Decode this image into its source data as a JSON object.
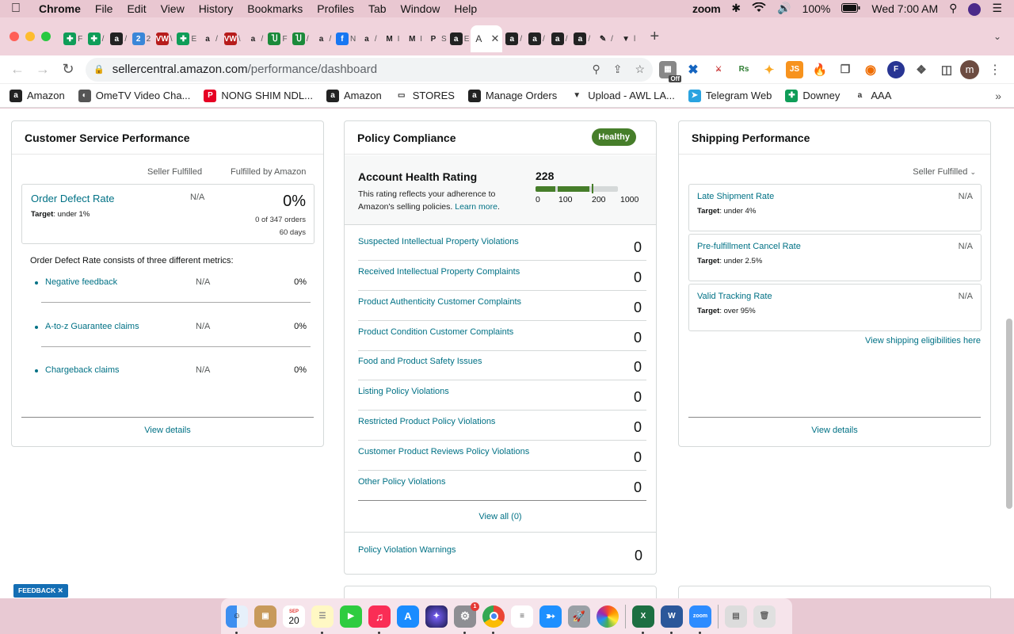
{
  "menubar": {
    "app": "Chrome",
    "menus": [
      "File",
      "Edit",
      "View",
      "History",
      "Bookmarks",
      "Profiles",
      "Tab",
      "Window",
      "Help"
    ],
    "zoom": "zoom",
    "battery": "100%",
    "clock": "Wed 7:00 AM"
  },
  "tabs": {
    "active_title": "A",
    "close_glyph": "✕",
    "new_tab": "+",
    "items": [
      {
        "label": "F",
        "color": "#0f9d58",
        "glyph": "✚"
      },
      {
        "label": "/",
        "color": "#0f9d58",
        "glyph": "✚"
      },
      {
        "label": "/",
        "color": "#222",
        "glyph": "a"
      },
      {
        "label": "2",
        "color": "#3a86d8",
        "glyph": "2"
      },
      {
        "label": "\\",
        "color": "#b71c1c",
        "glyph": "VW"
      },
      {
        "label": "E",
        "color": "#0f9d58",
        "glyph": "✚"
      },
      {
        "label": "/",
        "color": "#fff",
        "glyph": "a"
      },
      {
        "label": "\\",
        "color": "#b71c1c",
        "glyph": "VW"
      },
      {
        "label": "/",
        "color": "#fff",
        "glyph": "a"
      },
      {
        "label": "F",
        "color": "#1b8a3a",
        "glyph": "Ⴎ"
      },
      {
        "label": "/",
        "color": "#1b8a3a",
        "glyph": "Ⴎ"
      },
      {
        "label": "/",
        "color": "#fff",
        "glyph": "a"
      },
      {
        "label": "N",
        "color": "#1877f2",
        "glyph": "f"
      },
      {
        "label": "/",
        "color": "#fff",
        "glyph": "a"
      },
      {
        "label": "I",
        "color": "#fff",
        "glyph": "M"
      },
      {
        "label": "I",
        "color": "#fff",
        "glyph": "M"
      },
      {
        "label": "S",
        "color": "#fff",
        "glyph": "P"
      },
      {
        "label": "E",
        "color": "#222",
        "glyph": "a"
      }
    ],
    "items_after": [
      {
        "label": "/",
        "color": "#222",
        "glyph": "a"
      },
      {
        "label": "/",
        "color": "#222",
        "glyph": "a"
      },
      {
        "label": "/",
        "color": "#222",
        "glyph": "a"
      },
      {
        "label": "/",
        "color": "#222",
        "glyph": "a"
      },
      {
        "label": "/",
        "color": "#fff",
        "glyph": "✎"
      },
      {
        "label": "l",
        "color": "#fff",
        "glyph": "▼"
      }
    ]
  },
  "address": {
    "domain": "sellercentral.amazon.com",
    "path": "/performance/dashboard"
  },
  "extensions": {
    "off_badge": "Off",
    "rs": "Rs",
    "js": "JS",
    "profile_initial": "m"
  },
  "bookmarks": [
    {
      "label": "Amazon",
      "color": "#222",
      "glyph": "a"
    },
    {
      "label": "OmeTV Video Cha...",
      "color": "#555",
      "glyph": "◐"
    },
    {
      "label": "NONG SHIM NDL...",
      "color": "#e60023",
      "glyph": "P"
    },
    {
      "label": "Amazon",
      "color": "#222",
      "glyph": "a"
    },
    {
      "label": "STORES",
      "color": "#fff",
      "glyph": "▭"
    },
    {
      "label": "Manage Orders",
      "color": "#222",
      "glyph": "a"
    },
    {
      "label": "Upload - AWL LA...",
      "color": "#fff",
      "glyph": "▼"
    },
    {
      "label": "Telegram Web",
      "color": "#2aa3e0",
      "glyph": "➤"
    },
    {
      "label": "Downey",
      "color": "#0f9d58",
      "glyph": "✚"
    },
    {
      "label": "AAA",
      "color": "#fff",
      "glyph": "a"
    }
  ],
  "customer_service": {
    "title": "Customer Service Performance",
    "col_seller": "Seller Fulfilled",
    "col_fba": "Fulfilled by Amazon",
    "odr_title": "Order Defect Rate",
    "odr_target_label": "Target",
    "odr_target_value": ": under 1%",
    "odr_seller": "N/A",
    "odr_fba": "0%",
    "odr_orders": "0 of 347 orders",
    "odr_period": "60 days",
    "intro": "Order Defect Rate consists of three different metrics:",
    "metrics": [
      {
        "name": "Negative feedback",
        "seller": "N/A",
        "fba": "0%"
      },
      {
        "name": "A-to-z Guarantee claims",
        "seller": "N/A",
        "fba": "0%"
      },
      {
        "name": "Chargeback claims",
        "seller": "N/A",
        "fba": "0%"
      }
    ],
    "view_details": "View details"
  },
  "policy": {
    "title": "Policy Compliance",
    "status": "Healthy",
    "ahr_title": "Account Health Rating",
    "ahr_desc": "This rating reflects your adherence to Amazon's selling policies.",
    "ahr_learn": "Learn more",
    "ahr_score": "228",
    "ahr_scale": [
      "0",
      "100",
      "200",
      "1000"
    ],
    "rows": [
      {
        "name": "Suspected Intellectual Property Violations",
        "value": "0"
      },
      {
        "name": "Received Intellectual Property Complaints",
        "value": "0"
      },
      {
        "name": "Product Authenticity Customer Complaints",
        "value": "0"
      },
      {
        "name": "Product Condition Customer Complaints",
        "value": "0"
      },
      {
        "name": "Food and Product Safety Issues",
        "value": "0"
      },
      {
        "name": "Listing Policy Violations",
        "value": "0"
      },
      {
        "name": "Restricted Product Policy Violations",
        "value": "0"
      },
      {
        "name": "Customer Product Reviews Policy Violations",
        "value": "0"
      },
      {
        "name": "Other Policy Violations",
        "value": "0"
      }
    ],
    "view_all": "View all (0)",
    "warnings_label": "Policy Violation Warnings",
    "warnings_value": "0"
  },
  "shipping": {
    "title": "Shipping Performance",
    "filter": "Seller Fulfilled",
    "metrics": [
      {
        "name": "Late Shipment Rate",
        "target_label": "Target",
        "target": ": under 4%",
        "value": "N/A"
      },
      {
        "name": "Pre-fulfillment Cancel Rate",
        "target_label": "Target",
        "target": ": under 2.5%",
        "value": "N/A"
      },
      {
        "name": "Valid Tracking Rate",
        "target_label": "Target",
        "target": ": over 95%",
        "value": "N/A"
      }
    ],
    "eligibility_link": "View shipping eligibilities here",
    "view_details": "View details"
  },
  "feedback_button": "FEEDBACK",
  "dock": {
    "calendar_month": "SEP",
    "calendar_day": "20",
    "zoom_label": "zoom",
    "settings_badge": "1"
  }
}
